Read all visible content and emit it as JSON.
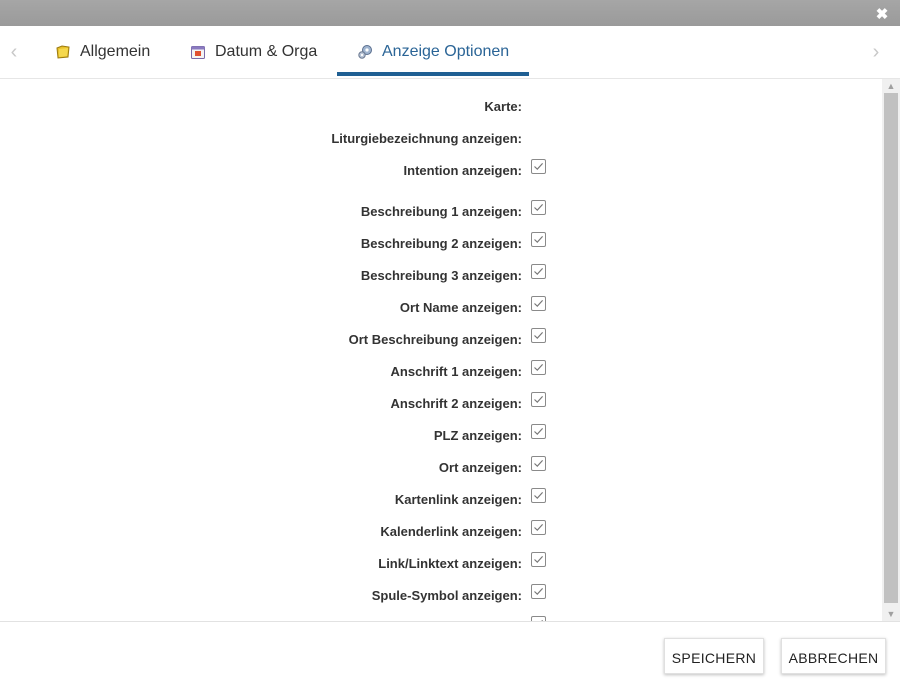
{
  "window": {
    "close_label": "✖"
  },
  "tabs": {
    "prev_arrow": "‹",
    "next_arrow": "›",
    "items": [
      {
        "label": "Allgemein",
        "icon": "folder-icon"
      },
      {
        "label": "Datum & Orga",
        "icon": "calendar-icon"
      },
      {
        "label": "Anzeige Optionen",
        "icon": "options-icon",
        "active": true
      }
    ]
  },
  "form": {
    "rows": [
      {
        "label": "Karte:",
        "checked": null
      },
      {
        "label": "Liturgiebezeichnung anzeigen:",
        "checked": null
      },
      {
        "label": "Intention anzeigen:",
        "checked": true
      },
      {
        "label": "Beschreibung 1 anzeigen:",
        "checked": true
      },
      {
        "label": "Beschreibung 2 anzeigen:",
        "checked": true
      },
      {
        "label": "Beschreibung 3 anzeigen:",
        "checked": true
      },
      {
        "label": "Ort Name anzeigen:",
        "checked": true
      },
      {
        "label": "Ort Beschreibung anzeigen:",
        "checked": true
      },
      {
        "label": "Anschrift 1 anzeigen:",
        "checked": true
      },
      {
        "label": "Anschrift 2 anzeigen:",
        "checked": true
      },
      {
        "label": "PLZ anzeigen:",
        "checked": true
      },
      {
        "label": "Ort anzeigen:",
        "checked": true
      },
      {
        "label": "Kartenlink anzeigen:",
        "checked": true
      },
      {
        "label": "Kalenderlink anzeigen:",
        "checked": true
      },
      {
        "label": "Link/Linktext anzeigen:",
        "checked": true
      },
      {
        "label": "Spule-Symbol anzeigen:",
        "checked": true
      }
    ]
  },
  "footer": {
    "save_label": "SPEICHERN",
    "cancel_label": "ABBRECHEN"
  },
  "colors": {
    "accent": "#1f5f93",
    "active_tab_text": "#2a6496",
    "header_bar": "#a0a0a0"
  }
}
